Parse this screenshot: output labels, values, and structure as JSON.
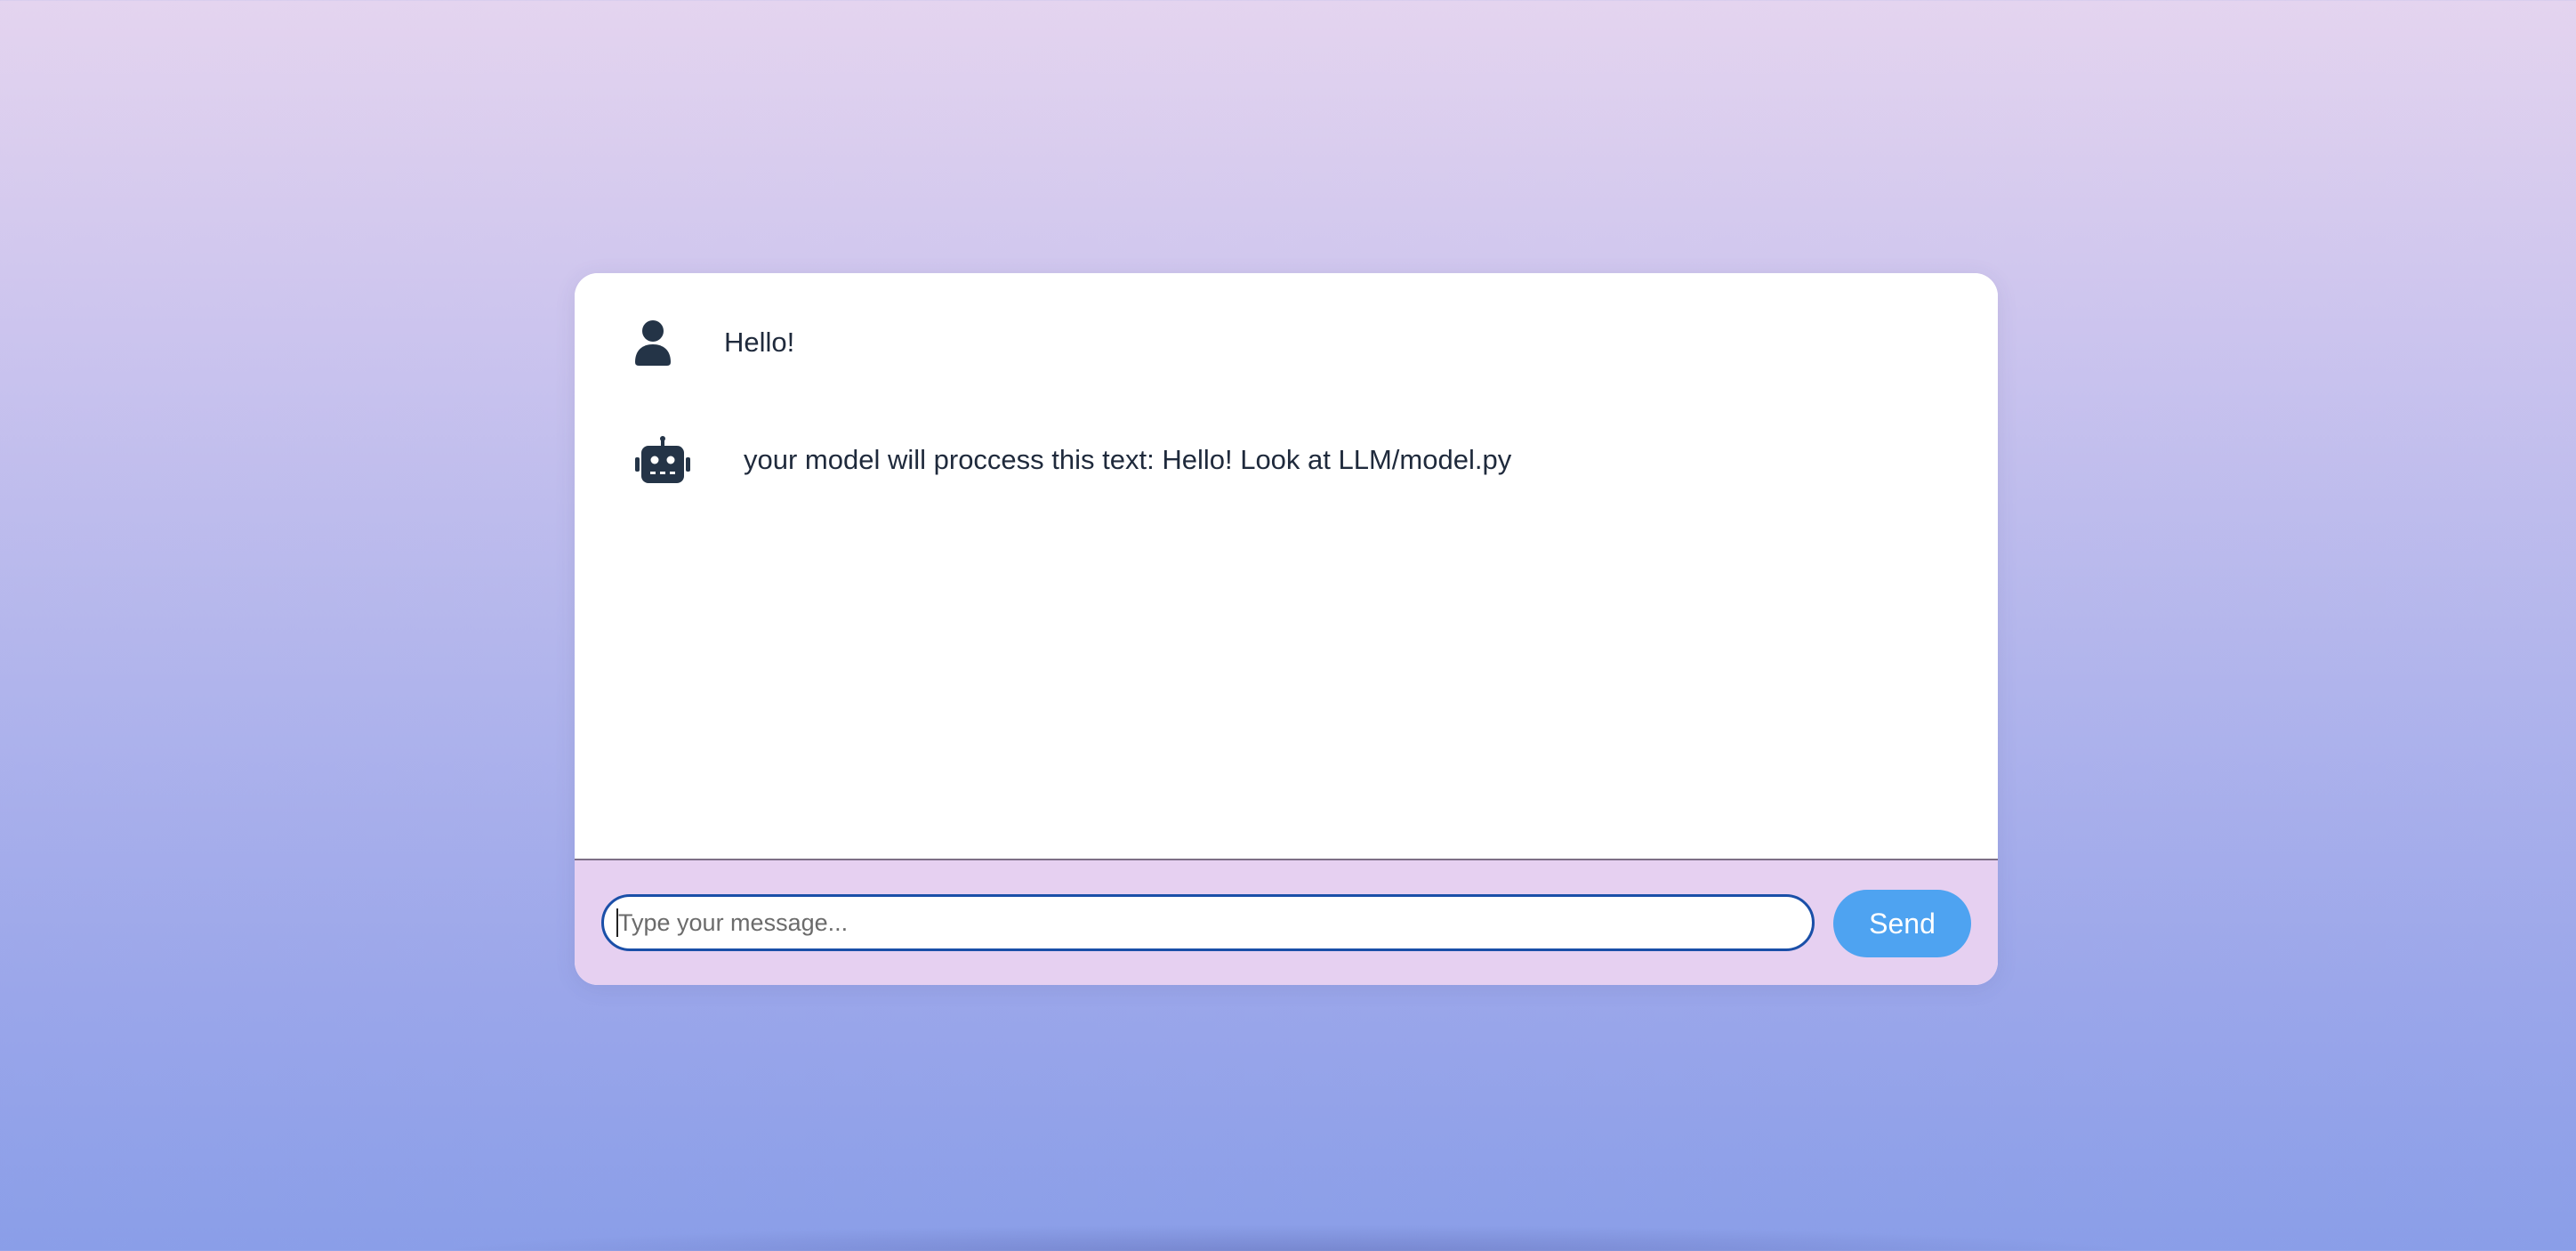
{
  "colors": {
    "accent": "#4ea3f1",
    "input_border": "#1a4fa8",
    "input_area_bg": "#e6d0f1",
    "text": "#1f2a3c"
  },
  "messages": [
    {
      "sender": "user",
      "icon": "user-icon",
      "text": "Hello!"
    },
    {
      "sender": "bot",
      "icon": "robot-icon",
      "text": "your model will proccess this text: Hello! Look at LLM/model.py"
    }
  ],
  "input": {
    "value": "",
    "placeholder": "Type your message..."
  },
  "send_button": {
    "label": "Send"
  }
}
